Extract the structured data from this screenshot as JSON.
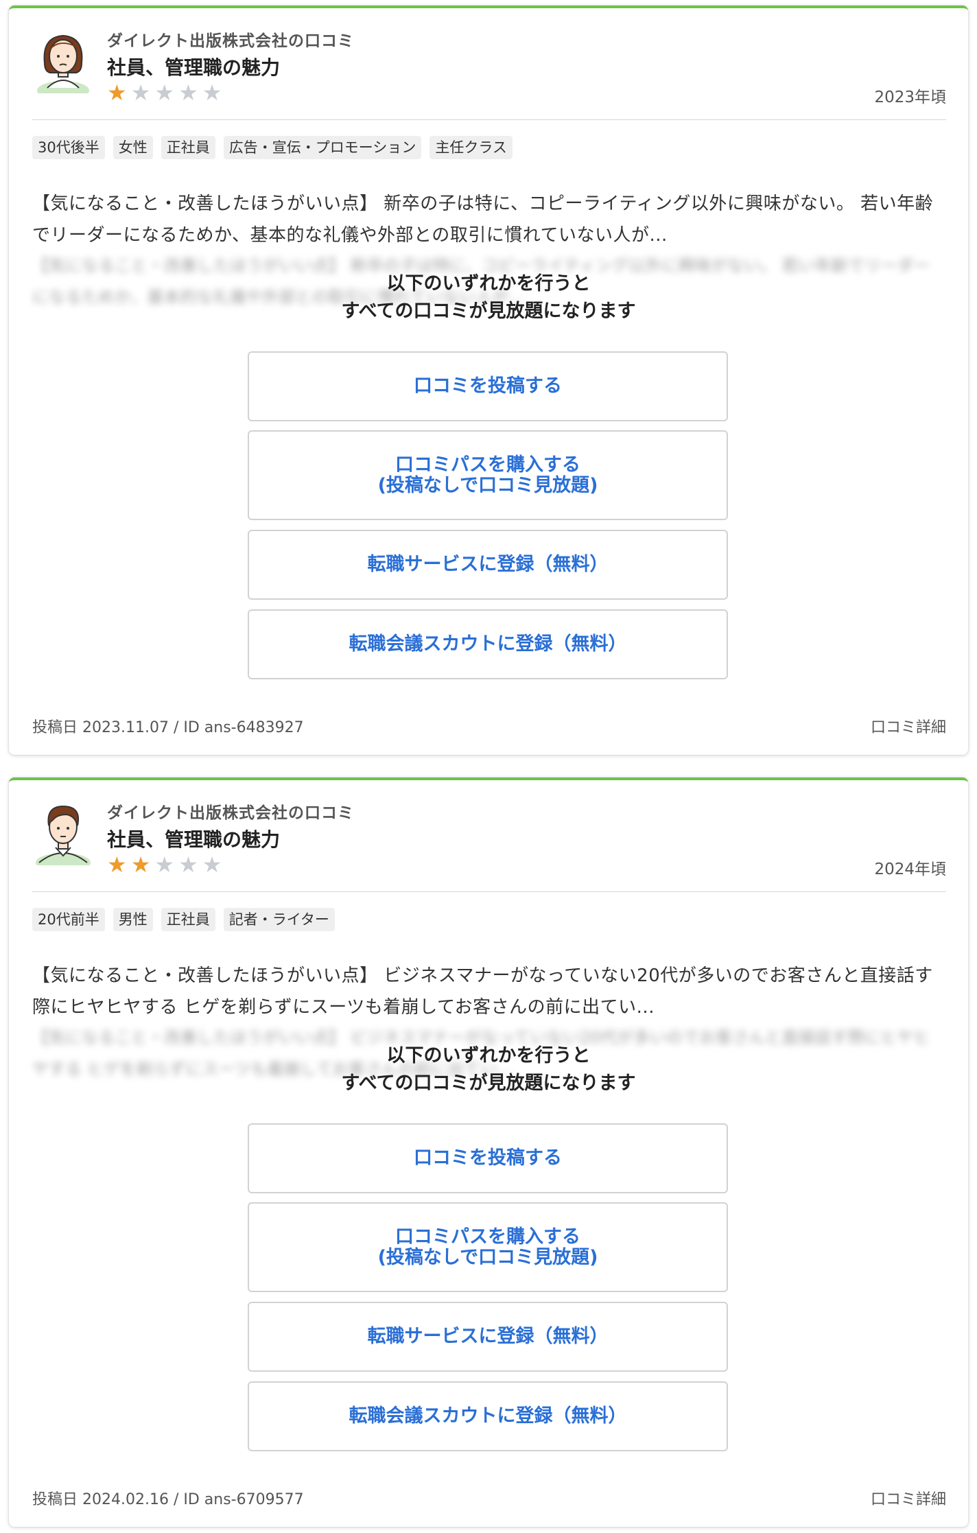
{
  "overlay": {
    "line1": "以下のいずれかを行うと",
    "line2": "すべての口コミが見放題になります",
    "buttons": {
      "post": "口コミを投稿する",
      "pass_line1": "口コミパスを購入する",
      "pass_line2": "(投稿なしで口コミ見放題)",
      "jobservice": "転職サービスに登録（無料）",
      "scout": "転職会議スカウトに登録（無料）"
    }
  },
  "colors": {
    "accent_green": "#6cc24a",
    "link_blue": "#2a6fd6",
    "star_on": "#ef9a2a",
    "star_off": "#c9ccd1"
  },
  "reviews": [
    {
      "company": "ダイレクト出版株式会社の口コミ",
      "title": "社員、管理職の魅力",
      "rating": 1,
      "date": "2023年頃",
      "avatar": "female-avatar-icon",
      "tags": [
        "30代後半",
        "女性",
        "正社員",
        "広告・宣伝・プロモーション",
        "主任クラス"
      ],
      "excerpt": "【気になること・改善したほうがいい点】 新卒の子は特に、コピーライティング以外に興味がない。 若い年齢でリーダーになるためか、基本的な礼儀や外部との取引に慣れていない人が...",
      "posted": "投稿日 2023.11.07 / ID ans-6483927",
      "detail_link": "口コミ詳細"
    },
    {
      "company": "ダイレクト出版株式会社の口コミ",
      "title": "社員、管理職の魅力",
      "rating": 2,
      "date": "2024年頃",
      "avatar": "male-avatar-icon",
      "tags": [
        "20代前半",
        "男性",
        "正社員",
        "記者・ライター"
      ],
      "excerpt": "【気になること・改善したほうがいい点】 ビジネスマナーがなっていない20代が多いのでお客さんと直接話す際にヒヤヒヤする ヒゲを剃らずにスーツも着崩してお客さんの前に出てい...",
      "posted": "投稿日 2024.02.16 / ID ans-6709577",
      "detail_link": "口コミ詳細"
    }
  ]
}
